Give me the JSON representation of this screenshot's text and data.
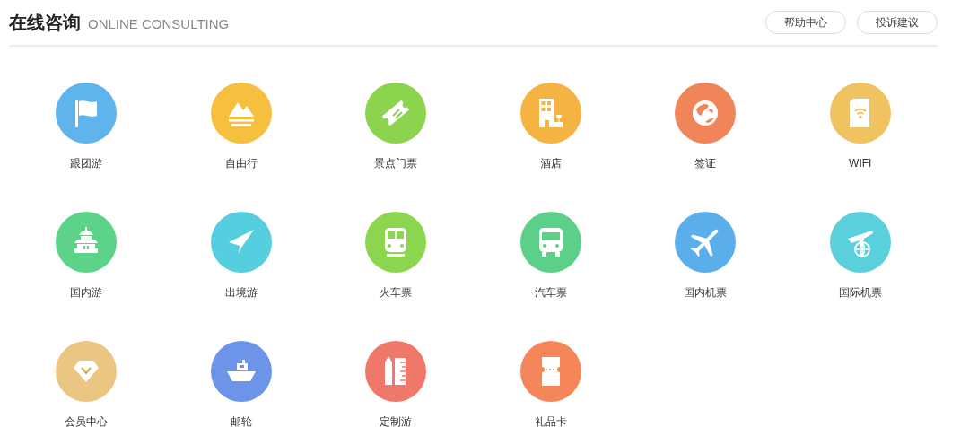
{
  "header": {
    "title": "在线咨询",
    "subtitle": "ONLINE CONSULTING",
    "buttons": [
      "帮助中心",
      "投诉建议"
    ]
  },
  "items": [
    {
      "label": "跟团游",
      "kind": "flag",
      "color": "#5fb4ec"
    },
    {
      "label": "自由行",
      "kind": "mountain",
      "color": "#f6bf3e"
    },
    {
      "label": "景点门票",
      "kind": "ticket",
      "color": "#8cd34e"
    },
    {
      "label": "酒店",
      "kind": "hotel",
      "color": "#f5b342"
    },
    {
      "label": "签证",
      "kind": "globe",
      "color": "#f0855a"
    },
    {
      "label": "WIFI",
      "kind": "sim",
      "color": "#f0c360"
    },
    {
      "label": "国内游",
      "kind": "pagoda",
      "color": "#5dd38a"
    },
    {
      "label": "出境游",
      "kind": "plane-paper",
      "color": "#55cfe0"
    },
    {
      "label": "火车票",
      "kind": "train",
      "color": "#8bd64e"
    },
    {
      "label": "汽车票",
      "kind": "bus",
      "color": "#5ccf88"
    },
    {
      "label": "国内机票",
      "kind": "airplane",
      "color": "#5aaeea"
    },
    {
      "label": "国际机票",
      "kind": "airplane-globe",
      "color": "#5ad0dc"
    },
    {
      "label": "会员中心",
      "kind": "diamond",
      "color": "#ebc683"
    },
    {
      "label": "邮轮",
      "kind": "ship",
      "color": "#6c94e8"
    },
    {
      "label": "定制游",
      "kind": "ruler",
      "color": "#f0786a"
    },
    {
      "label": "礼品卡",
      "kind": "card",
      "color": "#f4865a"
    }
  ]
}
